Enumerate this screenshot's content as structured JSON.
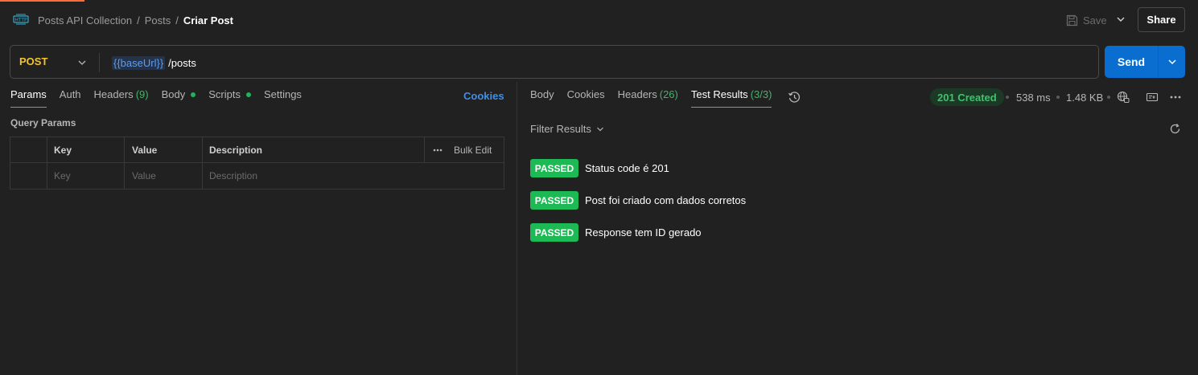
{
  "breadcrumb": {
    "collection": "Posts API Collection",
    "folder": "Posts",
    "request": "Criar Post",
    "separator": "/"
  },
  "toolbar": {
    "save_label": "Save",
    "share_label": "Share"
  },
  "request": {
    "method": "POST",
    "url_variable": "{{baseUrl}}",
    "url_path": "/posts",
    "send_label": "Send"
  },
  "request_tabs": [
    {
      "label": "Params",
      "count": ""
    },
    {
      "label": "Auth",
      "count": ""
    },
    {
      "label": "Headers",
      "count": "(9)"
    },
    {
      "label": "Body",
      "count": ""
    },
    {
      "label": "Scripts",
      "count": ""
    },
    {
      "label": "Settings",
      "count": ""
    }
  ],
  "cookies_link": "Cookies",
  "query_params": {
    "title": "Query Params",
    "headers": {
      "key": "Key",
      "value": "Value",
      "description": "Description",
      "bulk_edit": "Bulk Edit"
    },
    "placeholders": {
      "key": "Key",
      "value": "Value",
      "description": "Description"
    }
  },
  "response_tabs": [
    {
      "label": "Body",
      "count": ""
    },
    {
      "label": "Cookies",
      "count": ""
    },
    {
      "label": "Headers",
      "count": "(26)"
    },
    {
      "label": "Test Results",
      "count": "(3/3)"
    }
  ],
  "response_meta": {
    "status": "201 Created",
    "time": "538 ms",
    "size": "1.48 KB"
  },
  "filter_label": "Filter Results",
  "test_results": [
    {
      "status": "PASSED",
      "name": "Status code é 201"
    },
    {
      "status": "PASSED",
      "name": "Post foi criado com dados corretos"
    },
    {
      "status": "PASSED",
      "name": "Response tem ID gerado"
    }
  ],
  "colors": {
    "accent": "#ff6c37",
    "method": "#f4c430",
    "send": "#0a6ed1",
    "passed": "#1db954",
    "status_ok": "#3ec26b"
  }
}
